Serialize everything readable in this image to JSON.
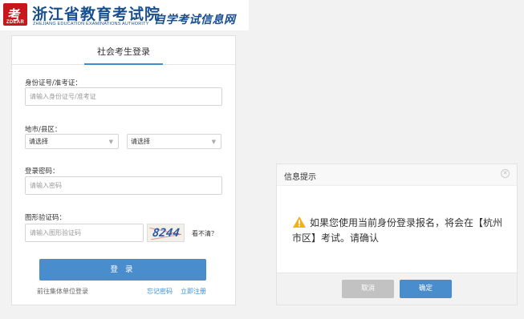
{
  "header": {
    "logo_text": "ZDEAR",
    "logo_char": "考",
    "title": "浙江省教育考试院",
    "subtitle": "ZHEJIANG EDUCATION EXAMINATIONS AUTHORITY",
    "slogan": "自学考试信息网"
  },
  "login": {
    "tab_label": "社会考生登录",
    "id_label": "身份证号/准考证：",
    "id_placeholder": "请输入身份证号/准考证",
    "region_label": "地市/县区：",
    "city_select": "请选择",
    "county_select": "请选择",
    "password_label": "登录密码：",
    "password_placeholder": "请输入密码",
    "captcha_label": "图形验证码：",
    "captcha_placeholder": "请输入图形验证码",
    "captcha_text": "8244",
    "captcha_refresh": "看不清？",
    "login_button": "登 录",
    "group_login_link": "前往集体单位登录",
    "forgot_link": "忘记密码",
    "register_link": "立即注册"
  },
  "dialog": {
    "title": "信息提示",
    "message": "如果您使用当前身份登录报名，将会在【杭州市区】考试。请确认",
    "cancel": "取消",
    "confirm": "确定"
  }
}
